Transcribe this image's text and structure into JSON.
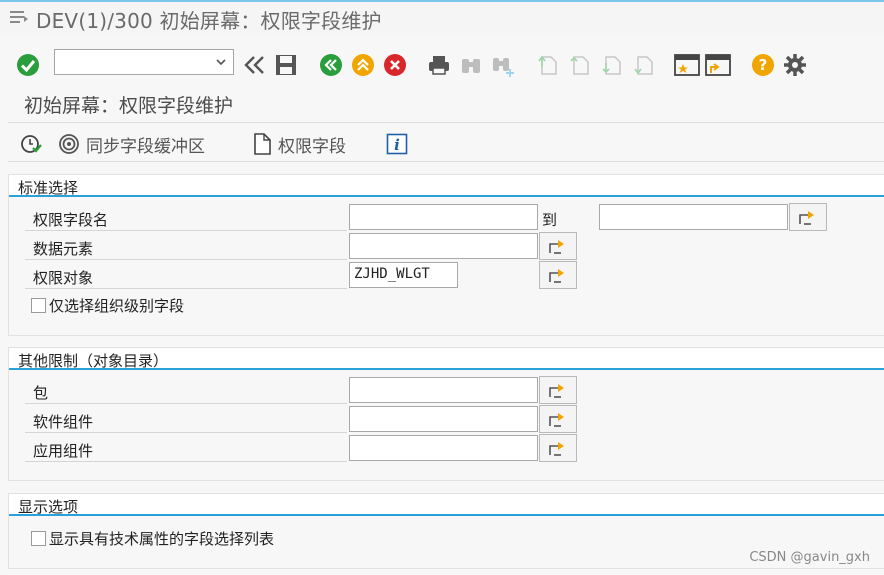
{
  "window": {
    "title": "DEV(1)/300 初始屏幕：权限字段维护",
    "menu_icon": "menu-icon"
  },
  "toolbar": {
    "command_field_value": "",
    "icons": [
      "confirm-icon",
      "dropdown-icon",
      "back-arrows-icon",
      "save-icon",
      "back-icon",
      "exit-icon",
      "cancel-icon",
      "print-icon",
      "find-icon",
      "find-next-icon",
      "first-page-icon",
      "previous-page-icon",
      "next-page-icon",
      "last-page-icon",
      "new-session-icon",
      "shortcut-icon",
      "help-icon",
      "settings-icon"
    ]
  },
  "screen": {
    "subtitle": "初始屏幕：权限字段维护"
  },
  "app_toolbar": {
    "execute_icon": "execute-icon",
    "sync_label": "同步字段缓冲区",
    "auth_field_label": "权限字段",
    "info_label": "i"
  },
  "groups": {
    "standard": {
      "title": "标准选择",
      "rows": [
        {
          "label": "权限字段名",
          "value": "",
          "to_label": "到",
          "to_value": ""
        },
        {
          "label": "数据元素",
          "value": ""
        },
        {
          "label": "权限对象",
          "value": "ZJHD_WLGT"
        }
      ],
      "checkbox_label": "仅选择组织级别字段",
      "checkbox_checked": false
    },
    "other": {
      "title": "其他限制（对象目录）",
      "rows": [
        {
          "label": "包",
          "value": ""
        },
        {
          "label": "软件组件",
          "value": ""
        },
        {
          "label": "应用组件",
          "value": ""
        }
      ]
    },
    "display": {
      "title": "显示选项",
      "checkbox_label": "显示具有技术属性的字段选择列表",
      "checkbox_checked": false
    }
  },
  "watermark": "CSDN @gavin_gxh",
  "colors": {
    "accent": "#2aa2d9",
    "confirm_green": "#2a9d3c",
    "help_orange": "#f0a500",
    "cancel_red": "#d9262b"
  }
}
